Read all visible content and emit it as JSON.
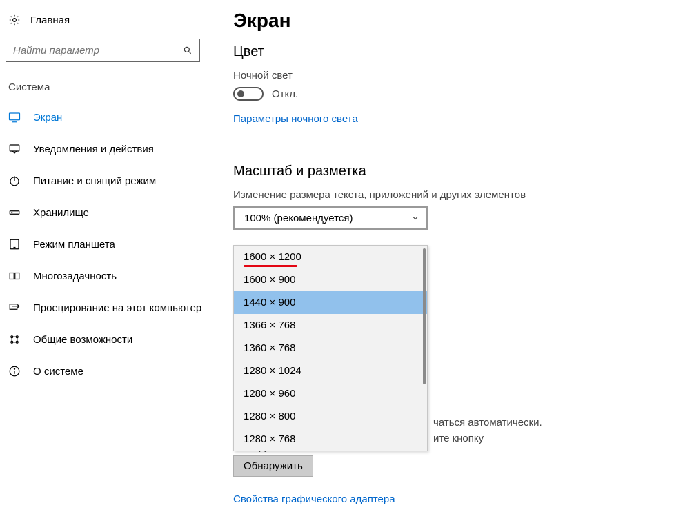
{
  "sidebar": {
    "home_label": "Главная",
    "search_placeholder": "Найти параметр",
    "section_title": "Система",
    "items": [
      {
        "label": "Экран",
        "icon": "display-icon",
        "active": true
      },
      {
        "label": "Уведомления и действия",
        "icon": "notifications-icon"
      },
      {
        "label": "Питание и спящий режим",
        "icon": "power-icon"
      },
      {
        "label": "Хранилище",
        "icon": "storage-icon"
      },
      {
        "label": "Режим планшета",
        "icon": "tablet-mode-icon"
      },
      {
        "label": "Многозадачность",
        "icon": "multitasking-icon"
      },
      {
        "label": "Проецирование на этот компьютер",
        "icon": "projecting-icon"
      },
      {
        "label": "Общие возможности",
        "icon": "shared-experiences-icon"
      },
      {
        "label": "О системе",
        "icon": "about-icon"
      }
    ]
  },
  "main": {
    "title": "Экран",
    "color_heading": "Цвет",
    "night_light_label": "Ночной свет",
    "night_light_state": "Откл.",
    "night_light_link": "Параметры ночного света",
    "scale_heading": "Масштаб и разметка",
    "scale_field_label": "Изменение размера текста, приложений и других элементов",
    "scale_value": "100% (рекомендуется)",
    "resolution_options": [
      "1600 × 1200",
      "1600 × 900",
      "1440 × 900",
      "1366 × 768",
      "1360 × 768",
      "1280 × 1024",
      "1280 × 960",
      "1280 × 800",
      "1280 × 768"
    ],
    "resolution_highlighted_index": 2,
    "resolution_underlined_index": 0,
    "partial_text_line1": "чаться автоматически.",
    "partial_text_line2": "ите кнопку",
    "partial_text_line3": "Обнаружить .",
    "detect_button": "Обнаружить",
    "adapter_link": "Свойства графического адаптера"
  }
}
